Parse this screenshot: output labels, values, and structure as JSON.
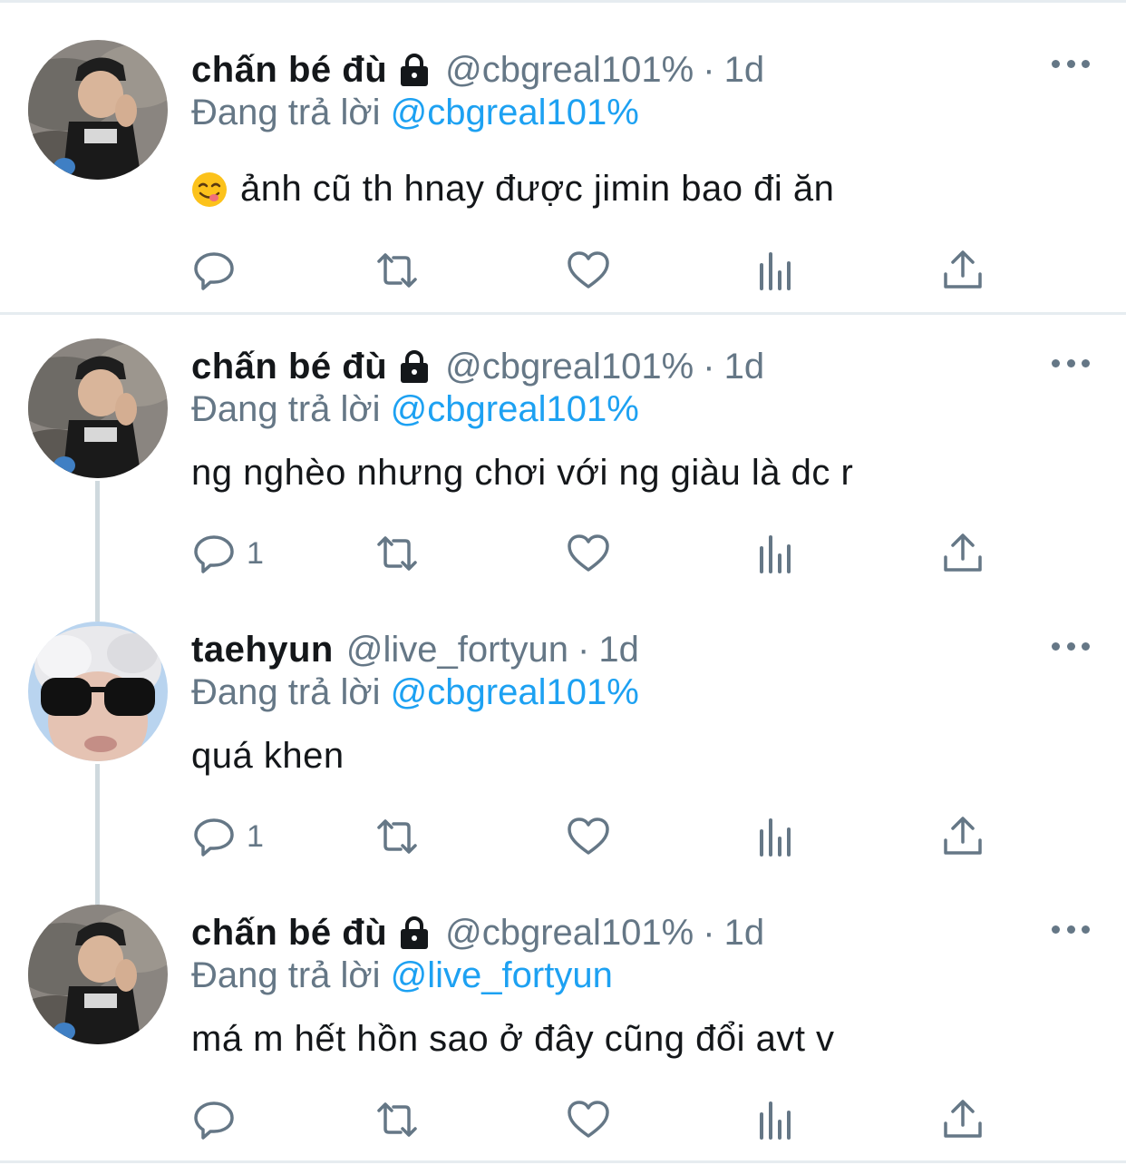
{
  "tweets": [
    {
      "name": "chấn bé đù",
      "locked": true,
      "handle": "@cbgreal101%",
      "separator": "·",
      "time": "1d",
      "replying_prefix": "Đang trả lời",
      "replying_to": "@cbgreal101%",
      "emoji": "savoring-food-emoji",
      "text": "ảnh cũ th hnay được jimin bao đi ăn",
      "reply_count": ""
    },
    {
      "name": "chấn bé đù",
      "locked": true,
      "handle": "@cbgreal101%",
      "separator": "·",
      "time": "1d",
      "replying_prefix": "Đang trả lời",
      "replying_to": "@cbgreal101%",
      "text": "ng nghèo nhưng chơi với ng giàu là dc r",
      "reply_count": "1"
    },
    {
      "name": "taehyun",
      "locked": false,
      "handle": "@live_fortyun",
      "separator": "·",
      "time": "1d",
      "replying_prefix": "Đang trả lời",
      "replying_to": "@cbgreal101%",
      "text": "quá khen",
      "reply_count": "1"
    },
    {
      "name": "chấn bé đù",
      "locked": true,
      "handle": "@cbgreal101%",
      "separator": "·",
      "time": "1d",
      "replying_prefix": "Đang trả lời",
      "replying_to": "@live_fortyun",
      "text": "má m hết hồn sao ở đây cũng đổi avt v",
      "reply_count": ""
    }
  ],
  "icons": {
    "reply": "speech-bubble-icon",
    "retweet": "retweet-arrows-icon",
    "like": "heart-icon",
    "stats": "bar-chart-icon",
    "share": "share-upload-icon",
    "more": "three-dots-icon",
    "lock": "lock-icon"
  },
  "colors": {
    "text": "#14171a",
    "secondary": "#657786",
    "link": "#1da1f2",
    "divider": "#e6ecf0",
    "thread_line": "#cfd9de"
  }
}
